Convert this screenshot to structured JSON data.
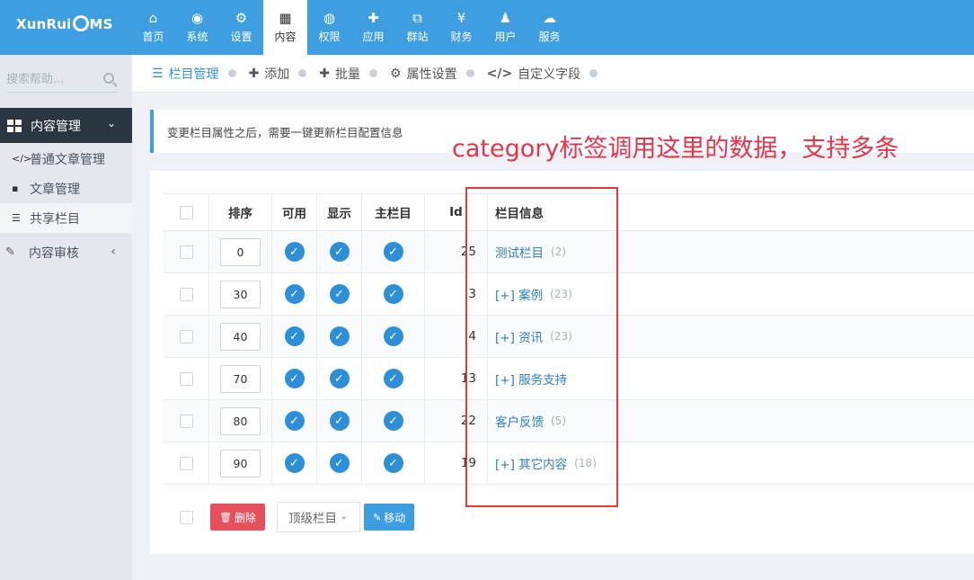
{
  "header": {
    "logo": {
      "left": "XunRui",
      "right": "MS"
    },
    "nav": [
      {
        "label": "首页",
        "icon": "home-icon",
        "glyph": "⌂"
      },
      {
        "label": "系统",
        "icon": "globe-icon",
        "glyph": "◉"
      },
      {
        "label": "设置",
        "icon": "gears-icon",
        "glyph": "⚙"
      },
      {
        "label": "内容",
        "icon": "grid-icon",
        "glyph": "▦",
        "active": true
      },
      {
        "label": "权限",
        "icon": "user-circle-icon",
        "glyph": "◍"
      },
      {
        "label": "应用",
        "icon": "puzzle-icon",
        "glyph": "✚"
      },
      {
        "label": "群站",
        "icon": "sitemap-icon",
        "glyph": "⧉"
      },
      {
        "label": "财务",
        "icon": "yen-icon",
        "glyph": "¥"
      },
      {
        "label": "用户",
        "icon": "user-icon",
        "glyph": "♟"
      },
      {
        "label": "服务",
        "icon": "cloud-icon",
        "glyph": "☁"
      }
    ]
  },
  "sidebar": {
    "search_placeholder": "搜索帮助...",
    "group_label": "内容管理",
    "items": [
      {
        "label": "普通文章管理",
        "icon": "code-icon",
        "glyph": "</>"
      },
      {
        "label": "文章管理",
        "icon": "file-icon",
        "glyph": "▪"
      },
      {
        "label": "共享栏目",
        "icon": "list-icon",
        "glyph": "☰",
        "active": true
      }
    ],
    "group2_label": "内容审核"
  },
  "breadcrumb": [
    {
      "label": "栏目管理",
      "glyph": "☰",
      "active": true
    },
    {
      "label": "添加",
      "glyph": "✚"
    },
    {
      "label": "批量",
      "glyph": "✚"
    },
    {
      "label": "属性设置",
      "glyph": "⚙"
    },
    {
      "label": "自定义字段",
      "glyph": "</>"
    }
  ],
  "notice": "变更栏目属性之后，需要一键更新栏目配置信息",
  "annotation": "category标签调用这里的数据，支持多条",
  "table": {
    "headers": {
      "sort": "排序",
      "enabled": "可用",
      "show": "显示",
      "main": "主栏目",
      "id": "Id",
      "info": "栏目信息"
    },
    "rows": [
      {
        "sort": "0",
        "id": "25",
        "name": "测试栏目",
        "count": "(2)"
      },
      {
        "sort": "30",
        "id": "3",
        "name": "[+] 案例",
        "count": "(23)"
      },
      {
        "sort": "40",
        "id": "4",
        "name": "[+] 资讯",
        "count": "(23)"
      },
      {
        "sort": "70",
        "id": "13",
        "name": "[+] 服务支持",
        "count": ""
      },
      {
        "sort": "80",
        "id": "22",
        "name": "客户反馈",
        "count": "(5)"
      },
      {
        "sort": "90",
        "id": "19",
        "name": "[+] 其它内容",
        "count": "(18)"
      }
    ]
  },
  "footer": {
    "delete_label": "删除",
    "select_value": "顶级栏目",
    "move_label": "移动"
  },
  "colors": {
    "header": "#3e9ee0",
    "sidebar_active": "#2b3643",
    "annotation": "#e8344b",
    "check": "#2c8fd7"
  }
}
